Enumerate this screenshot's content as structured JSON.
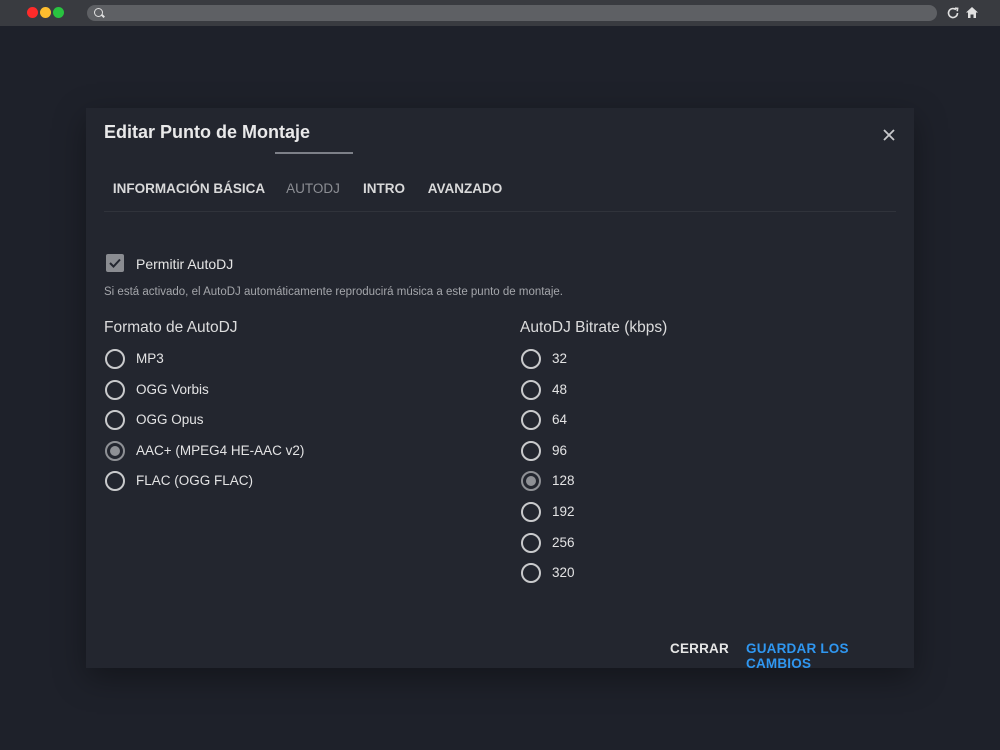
{
  "browser": {
    "window_controls": [
      "close",
      "minimize",
      "zoom"
    ],
    "icons": [
      "search-icon",
      "reload-icon",
      "home-icon"
    ]
  },
  "dialog": {
    "title": "Editar Punto de Montaje",
    "close_icon": "close-icon",
    "tabs": [
      {
        "label": "INFORMACIÓN BÁSICA",
        "active": false
      },
      {
        "label": "AUTODJ",
        "active": true
      },
      {
        "label": "INTRO",
        "active": false
      },
      {
        "label": "AVANZADO",
        "active": false
      }
    ],
    "enable_autodj": {
      "label": "Permitir AutoDJ",
      "checked": true,
      "help": "Si está activado, el AutoDJ automáticamente reproducirá música a este punto de montaje."
    },
    "format": {
      "title": "Formato de AutoDJ",
      "options": [
        "MP3",
        "OGG Vorbis",
        "OGG Opus",
        "AAC+ (MPEG4 HE-AAC v2)",
        "FLAC (OGG FLAC)"
      ],
      "selected": "AAC+ (MPEG4 HE-AAC v2)"
    },
    "bitrate": {
      "title": "AutoDJ Bitrate (kbps)",
      "options": [
        "32",
        "48",
        "64",
        "96",
        "128",
        "192",
        "256",
        "320"
      ],
      "selected": "128"
    },
    "buttons": {
      "close": "CERRAR",
      "save": "GUARDAR LOS CAMBIOS"
    }
  },
  "colors": {
    "page_bg": "#1e212a",
    "dialog_bg": "#23262f",
    "accent": "#2f97f1"
  }
}
